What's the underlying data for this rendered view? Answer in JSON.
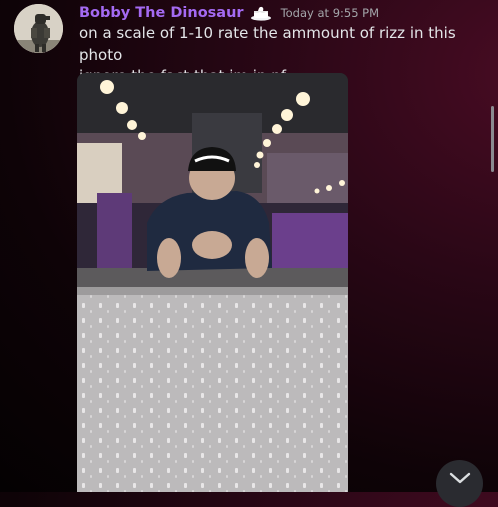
{
  "message": {
    "author": "Bobby The Dinosaur",
    "author_color": "#a46af2",
    "role_icon": "cake-icon",
    "timestamp": "Today at 9:55 PM",
    "lines": [
      "on a scale of 1-10 rate the ammount of rizz in this photo",
      "ignore the fact that im in pf"
    ],
    "attachment": {
      "kind": "image",
      "description_icon": "mirror-selfie-photo"
    }
  },
  "controls": {
    "jump_icon": "chevron-down-icon"
  },
  "colors": {
    "background": "#1a0610",
    "timestamp": "#a3a6aa",
    "text": "#e3e5e8"
  }
}
